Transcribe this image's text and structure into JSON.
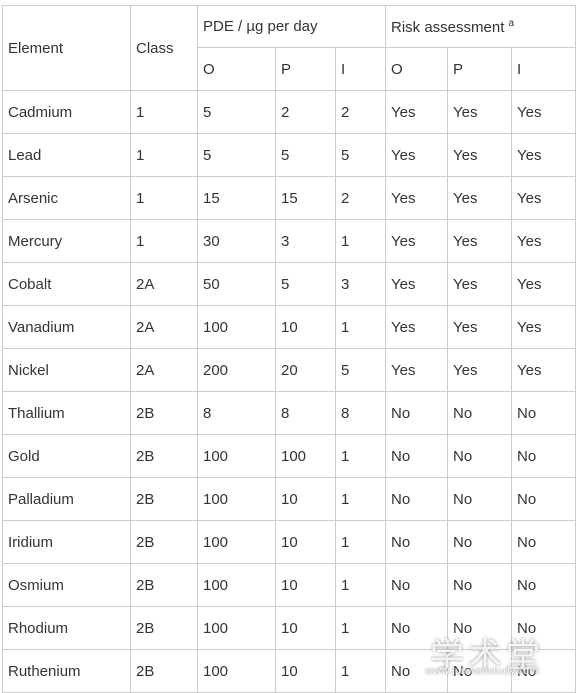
{
  "table": {
    "headers": {
      "element": "Element",
      "class": "Class",
      "pde_group": "PDE / µg per day",
      "risk_group": "Risk assessment",
      "risk_footnote": "a",
      "sub": [
        "O",
        "P",
        "I",
        "O",
        "P",
        "I"
      ]
    },
    "rows": [
      {
        "element": "Cadmium",
        "class": "1",
        "pde": [
          "5",
          "2",
          "2"
        ],
        "risk": [
          "Yes",
          "Yes",
          "Yes"
        ]
      },
      {
        "element": "Lead",
        "class": "1",
        "pde": [
          "5",
          "5",
          "5"
        ],
        "risk": [
          "Yes",
          "Yes",
          "Yes"
        ]
      },
      {
        "element": "Arsenic",
        "class": "1",
        "pde": [
          "15",
          "15",
          "2"
        ],
        "risk": [
          "Yes",
          "Yes",
          "Yes"
        ]
      },
      {
        "element": "Mercury",
        "class": "1",
        "pde": [
          "30",
          "3",
          "1"
        ],
        "risk": [
          "Yes",
          "Yes",
          "Yes"
        ]
      },
      {
        "element": "Cobalt",
        "class": "2A",
        "pde": [
          "50",
          "5",
          "3"
        ],
        "risk": [
          "Yes",
          "Yes",
          "Yes"
        ]
      },
      {
        "element": "Vanadium",
        "class": "2A",
        "pde": [
          "100",
          "10",
          "1"
        ],
        "risk": [
          "Yes",
          "Yes",
          "Yes"
        ]
      },
      {
        "element": "Nickel",
        "class": "2A",
        "pde": [
          "200",
          "20",
          "5"
        ],
        "risk": [
          "Yes",
          "Yes",
          "Yes"
        ]
      },
      {
        "element": "Thallium",
        "class": "2B",
        "pde": [
          "8",
          "8",
          "8"
        ],
        "risk": [
          "No",
          "No",
          "No"
        ]
      },
      {
        "element": "Gold",
        "class": "2B",
        "pde": [
          "100",
          "100",
          "1"
        ],
        "risk": [
          "No",
          "No",
          "No"
        ]
      },
      {
        "element": "Palladium",
        "class": "2B",
        "pde": [
          "100",
          "10",
          "1"
        ],
        "risk": [
          "No",
          "No",
          "No"
        ]
      },
      {
        "element": "Iridium",
        "class": "2B",
        "pde": [
          "100",
          "10",
          "1"
        ],
        "risk": [
          "No",
          "No",
          "No"
        ]
      },
      {
        "element": "Osmium",
        "class": "2B",
        "pde": [
          "100",
          "10",
          "1"
        ],
        "risk": [
          "No",
          "No",
          "No"
        ]
      },
      {
        "element": "Rhodium",
        "class": "2B",
        "pde": [
          "100",
          "10",
          "1"
        ],
        "risk": [
          "No",
          "No",
          "No"
        ]
      },
      {
        "element": "Ruthenium",
        "class": "2B",
        "pde": [
          "100",
          "10",
          "1"
        ],
        "risk": [
          "No",
          "No",
          "No"
        ]
      }
    ]
  },
  "watermark": {
    "text": "学术堂",
    "url": "www.lunwenstudy.com"
  }
}
